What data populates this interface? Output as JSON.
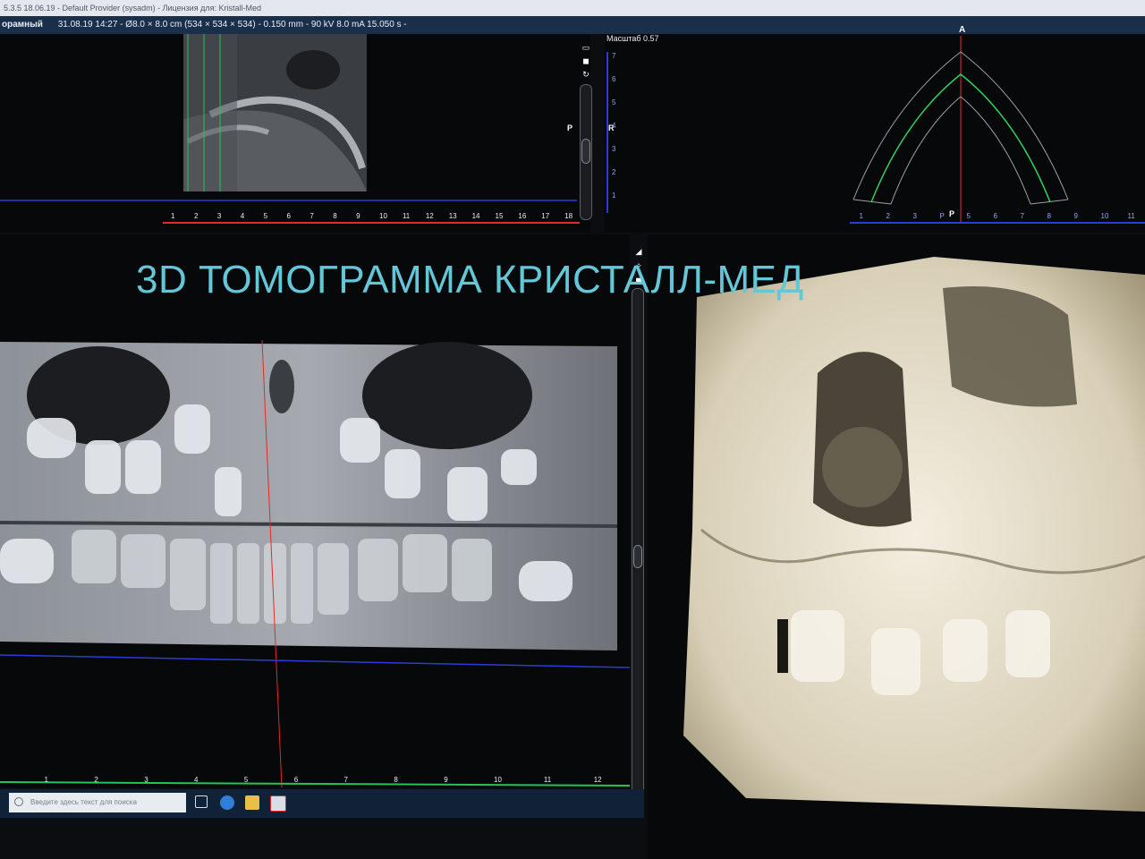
{
  "window": {
    "title": "5.3.5 18.06.19 - Default Provider (sysadm) - Лицензия для: Kristall-Med"
  },
  "info_bar": {
    "mode": "орамный",
    "scan_meta": "31.08.19 14:27 - Ø8.0 × 8.0 cm (534 × 534 × 534) - 0.150 mm - 90 kV 8.0 mA 15.050 s -"
  },
  "sagittal_view": {
    "orientation_left": "P",
    "orientation_right": "R",
    "ruler_ticks": [
      "1",
      "2",
      "3",
      "4",
      "5",
      "6",
      "7",
      "8",
      "9",
      "10",
      "11",
      "12",
      "13",
      "14",
      "15",
      "16",
      "17",
      "18"
    ]
  },
  "arch_view": {
    "scale_label": "Масштаб 0.57",
    "orientation_top": "A",
    "bottom_marker": "P",
    "ruler_ticks": [
      "1",
      "2",
      "3",
      "P",
      "5",
      "6",
      "7",
      "8",
      "9",
      "10",
      "11"
    ],
    "side_ticks": [
      "7",
      "6",
      "5",
      "4",
      "3",
      "2",
      "1"
    ]
  },
  "overlay": {
    "title": "3D ТОМОГРАММА КРИСТАЛЛ-МЕД"
  },
  "panoramic_view": {
    "ruler_ticks": [
      "1",
      "2",
      "3",
      "4",
      "5",
      "6",
      "7",
      "8",
      "9",
      "10",
      "11",
      "12"
    ]
  },
  "taskbar": {
    "search_placeholder": "Введите здесь текст для поиска"
  },
  "colors": {
    "accent_title": "#63c7d8",
    "ruler_red": "#e22a2a",
    "ruler_blue": "#2a3cd8",
    "ruler_green": "#23c45a",
    "arch_curve": "#2fd05f"
  }
}
